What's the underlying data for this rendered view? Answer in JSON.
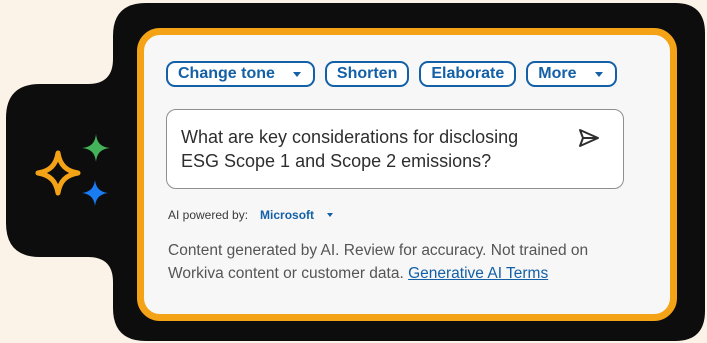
{
  "actions": {
    "change_tone_label": "Change tone",
    "shorten_label": "Shorten",
    "elaborate_label": "Elaborate",
    "more_label": "More"
  },
  "prompt": {
    "text": "What are key considerations for disclosing ESG Scope 1 and Scope 2 emissions?",
    "send_icon": "send-icon"
  },
  "powered_by": {
    "label": "AI powered by:",
    "provider": "Microsoft"
  },
  "disclaimer": {
    "text": "Content generated by AI. Review for accuracy. Not trained on Workiva content or customer data.",
    "link_label": "Generative AI Terms"
  },
  "colors": {
    "background": "#fbf2e8",
    "frame": "#0d0d0d",
    "panel_border": "#f5a316",
    "accent_blue": "#1360a7",
    "sparkle_orange": "#f5a316",
    "sparkle_green": "#45b35a",
    "sparkle_blue": "#1a7cf0"
  },
  "icons": {
    "sparkles": "ai-sparkles-icon",
    "dropdown": "chevron-down-icon"
  }
}
